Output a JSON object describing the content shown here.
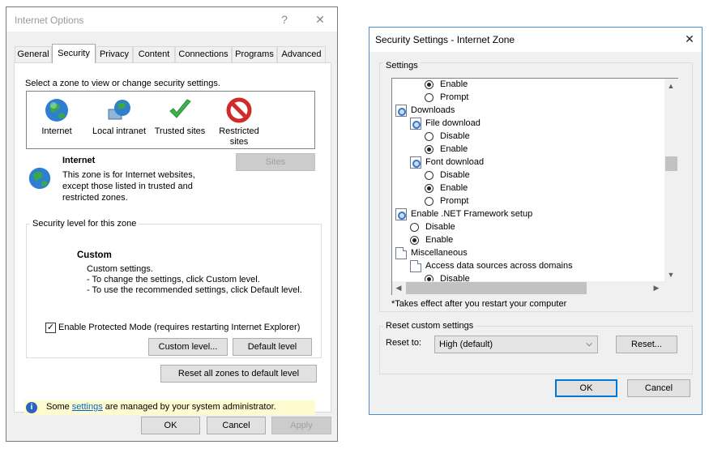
{
  "internet_options": {
    "title": "Internet Options",
    "help_glyph": "?",
    "close_glyph": "✕",
    "tabs": [
      {
        "label": "General"
      },
      {
        "label": "Security"
      },
      {
        "label": "Privacy"
      },
      {
        "label": "Content"
      },
      {
        "label": "Connections"
      },
      {
        "label": "Programs"
      },
      {
        "label": "Advanced"
      }
    ],
    "select_zone_text": "Select a zone to view or change security settings.",
    "zones": [
      {
        "label": "Internet"
      },
      {
        "label": "Local intranet"
      },
      {
        "label": "Trusted sites"
      },
      {
        "label": "Restricted sites"
      }
    ],
    "zone_info": {
      "name": "Internet",
      "description": "This zone is for Internet websites, except those listed in trusted and restricted zones."
    },
    "sites_button": "Sites",
    "security_level_title": "Security level for this zone",
    "custom_title": "Custom",
    "custom_lines": [
      "Custom settings.",
      "- To change the settings, click Custom level.",
      "- To use the recommended settings, click Default level."
    ],
    "protected_mode_label": "Enable Protected Mode (requires restarting Internet Explorer)",
    "protected_mode_checked": true,
    "custom_level_button": "Custom level...",
    "default_level_button": "Default level",
    "reset_all_button": "Reset all zones to default level",
    "info_bar": {
      "prefix": "Some ",
      "link": "settings",
      "suffix": " are managed by your system administrator."
    },
    "ok_button": "OK",
    "cancel_button": "Cancel",
    "apply_button": "Apply"
  },
  "security_settings": {
    "title": "Security Settings - Internet Zone",
    "close_glyph": "✕",
    "settings_label": "Settings",
    "tree": [
      {
        "kind": "radio",
        "label": "Enable",
        "checked": true,
        "level": 2
      },
      {
        "kind": "radio",
        "label": "Prompt",
        "checked": false,
        "level": 2
      },
      {
        "kind": "category",
        "label": "Downloads",
        "icon": "gear",
        "level": 0
      },
      {
        "kind": "setting",
        "label": "File download",
        "icon": "gear",
        "level": 1
      },
      {
        "kind": "radio",
        "label": "Disable",
        "checked": false,
        "level": 2
      },
      {
        "kind": "radio",
        "label": "Enable",
        "checked": true,
        "level": 2
      },
      {
        "kind": "setting",
        "label": "Font download",
        "icon": "gear",
        "level": 1
      },
      {
        "kind": "radio",
        "label": "Disable",
        "checked": false,
        "level": 2
      },
      {
        "kind": "radio",
        "label": "Enable",
        "checked": true,
        "level": 2
      },
      {
        "kind": "radio",
        "label": "Prompt",
        "checked": false,
        "level": 2
      },
      {
        "kind": "setting",
        "label": "Enable .NET Framework setup",
        "icon": "gear",
        "level": 0
      },
      {
        "kind": "radio",
        "label": "Disable",
        "checked": false,
        "level": 1
      },
      {
        "kind": "radio",
        "label": "Enable",
        "checked": true,
        "level": 1
      },
      {
        "kind": "category",
        "label": "Miscellaneous",
        "icon": "doc",
        "level": 0
      },
      {
        "kind": "setting",
        "label": "Access data sources across domains",
        "icon": "doc",
        "level": 1
      },
      {
        "kind": "radio",
        "label": "Disable",
        "checked": true,
        "level": 2
      }
    ],
    "takes_effect_note": "*Takes effect after you restart your computer",
    "reset_group_title": "Reset custom settings",
    "reset_to_label": "Reset to:",
    "reset_to_value": "High (default)",
    "reset_button": "Reset...",
    "ok_button": "OK",
    "cancel_button": "Cancel"
  }
}
